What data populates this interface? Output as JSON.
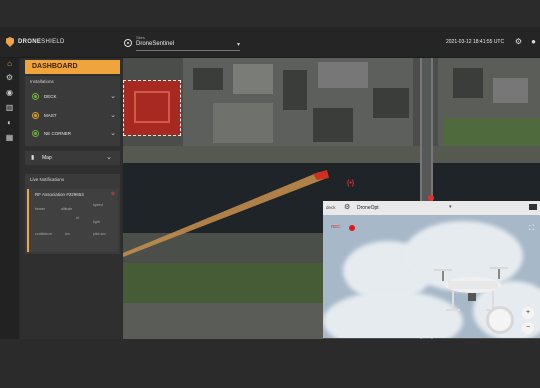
{
  "header": {
    "brand_prefix": "DRONE",
    "brand_suffix": "SHIELD",
    "site_label": "Sites",
    "site_value": "DroneSentinel",
    "clock": "2021-03-12 18:41:55 UTC"
  },
  "dashboard": {
    "title": "DASHBOARD",
    "installations_title": "Installations",
    "installations": [
      {
        "name": "DECK",
        "status": "ok"
      },
      {
        "name": "MAST",
        "status": "warn"
      },
      {
        "name": "NE CORNER",
        "status": "ok"
      }
    ],
    "map_label": "Map"
  },
  "notifications": {
    "title": "Live Notifications",
    "items": [
      {
        "heading": "RF Association #329653",
        "fields": {
          "bearing": "bearer",
          "altitude": "altitude",
          "speed": "speed",
          "id": "id",
          "flight": "fight",
          "confidence": "confidence",
          "freq": "ion",
          "pilot": "pilot sec"
        }
      }
    ]
  },
  "camera": {
    "source": "deck",
    "drone_name": "DroneOpt",
    "rec_label": "REC"
  },
  "colors": {
    "accent": "#f0a43c",
    "alert": "#e01818",
    "ok": "#6fae3f"
  }
}
